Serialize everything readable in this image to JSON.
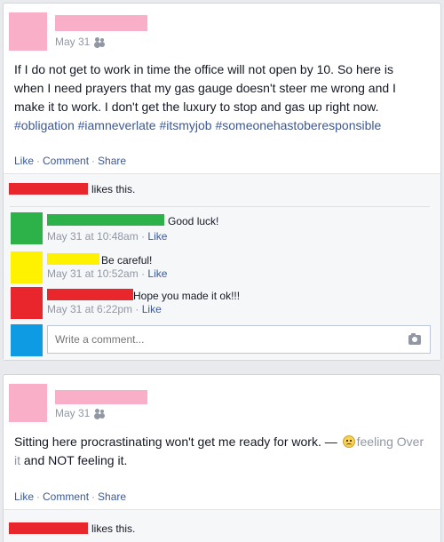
{
  "colors": {
    "link": "#3b5998",
    "meta": "#9197a3",
    "redact_pink": "#f9afc8",
    "redact_red": "#e8262c",
    "redact_green": "#2db24a",
    "redact_yellow": "#fff200",
    "redact_blue": "#0f9be3"
  },
  "post1": {
    "date": "May 31",
    "audience_icon": "friends-icon",
    "text": "If I do not get to work in time the office will not open by 10. So here is when I need prayers that my gas gauge doesn't steer me wrong and I make it to work. I don't get the luxury to stop and gas up right now.",
    "hashtags": [
      "#obligation",
      "#iamneverlate",
      "#itsmyjob",
      "#someonehastoberesponsible"
    ],
    "actions": {
      "like": "Like",
      "comment": "Comment",
      "share": "Share",
      "separator": "·"
    },
    "likes_suffix": "likes this.",
    "comments": [
      {
        "text": "Good luck!",
        "timestamp": "May 31 at 10:48am",
        "like": "Like",
        "separator": "·"
      },
      {
        "text": "Be careful!",
        "timestamp": "May 31 at 10:52am",
        "like": "Like",
        "separator": "·"
      },
      {
        "text": "Hope you made it ok!!!",
        "timestamp": "May 31 at 6:22pm",
        "like": "Like",
        "separator": "·"
      }
    ],
    "write_comment_placeholder": "Write a comment...",
    "camera_icon": "camera-icon"
  },
  "post2": {
    "date": "May 31",
    "audience_icon": "friends-icon",
    "text_before": "Sitting here procrastinating won't get me ready for work. —",
    "feeling_icon": "sad-face-icon",
    "feeling_text": "feeling Over it",
    "text_after": "and NOT feeling it.",
    "actions": {
      "like": "Like",
      "comment": "Comment",
      "share": "Share",
      "separator": "·"
    },
    "likes_suffix": "likes this."
  }
}
